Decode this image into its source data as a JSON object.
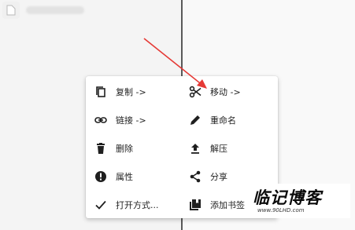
{
  "menu": {
    "items": [
      {
        "label": "复制 ->",
        "icon": "copy-icon"
      },
      {
        "label": "移动 ->",
        "icon": "scissors-icon"
      },
      {
        "label": "链接 ->",
        "icon": "link-icon"
      },
      {
        "label": "重命名",
        "icon": "pencil-icon"
      },
      {
        "label": "删除",
        "icon": "trash-icon"
      },
      {
        "label": "解压",
        "icon": "upload-icon"
      },
      {
        "label": "属性",
        "icon": "info-icon"
      },
      {
        "label": "分享",
        "icon": "share-icon"
      },
      {
        "label": "打开方式...",
        "icon": "check-icon"
      },
      {
        "label": "添加书签",
        "icon": "bookmark-icon"
      }
    ]
  },
  "annotation": {
    "arrow_color": "#e53935",
    "arrow_target": "移动 ->"
  },
  "watermark": {
    "title": "临记博客",
    "url": "www.90LHD.com"
  },
  "colors": {
    "icon": "#1f1f1f",
    "text": "#222222",
    "divider": "#5a5a5a"
  }
}
